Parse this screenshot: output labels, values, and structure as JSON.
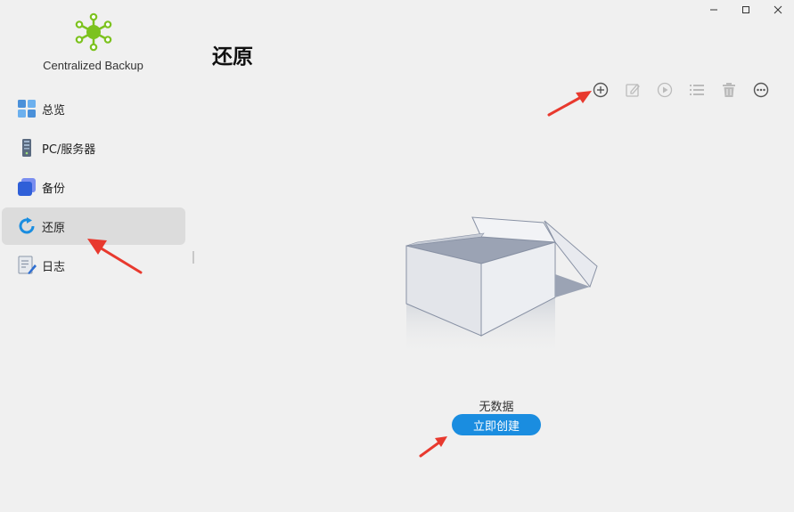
{
  "window": {
    "controls": {
      "minimize": "–",
      "maximize": "□",
      "close": "✕"
    }
  },
  "app": {
    "name": "Centralized Backup",
    "logo_icon": "network-hub-icon",
    "logo_color": "#7cc21e"
  },
  "sidebar": {
    "items": [
      {
        "label": "总览",
        "icon": "overview-tiles-icon",
        "active": false
      },
      {
        "label": "PC/服务器",
        "icon": "server-tower-icon",
        "active": false
      },
      {
        "label": "备份",
        "icon": "backup-cube-icon",
        "active": false
      },
      {
        "label": "还原",
        "icon": "restore-circular-arrow-icon",
        "active": true
      },
      {
        "label": "日志",
        "icon": "log-document-icon",
        "active": false
      }
    ]
  },
  "main": {
    "title": "还原",
    "toolbar": {
      "items": [
        {
          "icon": "add-circle-icon",
          "enabled": true
        },
        {
          "icon": "edit-icon",
          "enabled": false
        },
        {
          "icon": "play-icon",
          "enabled": false
        },
        {
          "icon": "list-icon",
          "enabled": false
        },
        {
          "icon": "trash-icon",
          "enabled": false
        },
        {
          "icon": "more-icon",
          "enabled": true
        }
      ]
    },
    "empty_state": {
      "illustration": "empty-box-icon",
      "message": "无数据",
      "action_label": "立即创建"
    }
  },
  "colors": {
    "accent": "#1a8de0",
    "annotation_arrow": "#e8392e",
    "active_item_bg": "#dcdcdc"
  }
}
